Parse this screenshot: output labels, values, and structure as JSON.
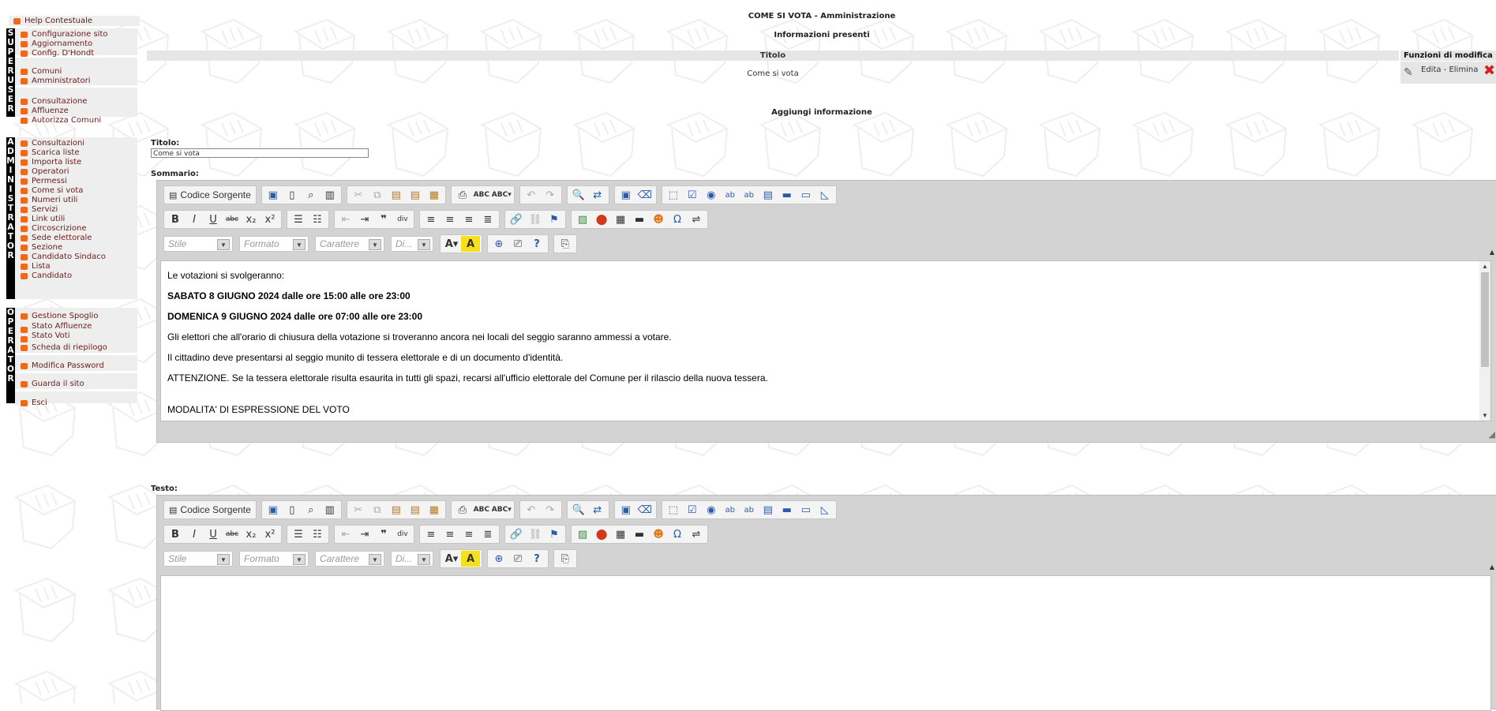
{
  "sidebar": {
    "help": "Help Contestuale",
    "groups": [
      {
        "letters": [
          "S",
          "U",
          "P",
          "E",
          "R",
          "U",
          "S",
          "E",
          "R"
        ],
        "sections": [
          [
            "Configurazione sito",
            "Aggiornamento",
            "Config. D'Hondt"
          ],
          [
            "Comuni",
            "Amministratori"
          ],
          [
            "Consultazione",
            "Affluenze",
            "Autorizza Comuni"
          ]
        ]
      },
      {
        "letters": [
          "A",
          "D",
          "M",
          "I",
          "N",
          "I",
          "S",
          "T",
          "R",
          "A",
          "T",
          "O",
          "R"
        ],
        "items": [
          "Consultazioni",
          "Scarica liste",
          "Importa liste",
          "Operatori",
          "Permessi",
          "Come si vota",
          "Numeri utili",
          "Servizi",
          "Link utili",
          "Circoscrizione",
          "Sede elettorale",
          "Sezione",
          "Candidato Sindaco",
          "Lista",
          "Candidato"
        ]
      },
      {
        "letters": [
          "O",
          "P",
          "E",
          "R",
          "A",
          "T",
          "O",
          "R"
        ],
        "sections": [
          [
            "Gestione Spoglio",
            "Stato Affluenze",
            "Stato Voti",
            "Scheda di riepilogo"
          ],
          [
            "Modifica Password"
          ],
          [
            "Guarda il sito"
          ],
          [
            "Esci"
          ]
        ]
      }
    ]
  },
  "header": {
    "title": "COME SI VOTA - Amministrazione",
    "subtitle": "Informazioni presenti"
  },
  "table": {
    "col_title": "Titolo",
    "col_functions": "Funzioni di modifica",
    "rows": [
      {
        "title": "Come si vota",
        "actions": "Edita - Elimina"
      }
    ]
  },
  "add": {
    "heading": "Aggiungi informazione",
    "title_label": "Titolo:",
    "title_value": "Come si vota",
    "summary_label": "Sommario:",
    "text_label": "Testo:"
  },
  "editor": {
    "source_label": "Codice Sorgente",
    "toolbar1": [
      "save-icon",
      "new-page-icon",
      "preview-icon",
      "templates-icon",
      "|",
      "cut-icon",
      "copy-icon",
      "paste-icon",
      "paste-text-icon",
      "paste-word-icon",
      "|",
      "print-icon",
      "spellcheck-icon",
      "scayt-icon",
      "|",
      "undo-icon",
      "redo-icon",
      "|",
      "find-icon",
      "replace-icon",
      "|",
      "select-all-icon",
      "remove-format-icon",
      "|",
      "form-icon",
      "checkbox-icon",
      "radio-icon",
      "textfield-icon",
      "textarea-icon",
      "select-field-icon",
      "button-icon",
      "image-button-icon",
      "hidden-field-icon"
    ],
    "toolbar2": [
      "B",
      "I",
      "U",
      "abc",
      "x₂",
      "x²",
      "|",
      "ol",
      "ul",
      "|",
      "outdent",
      "indent",
      "quote",
      "div",
      "|",
      "left",
      "center",
      "right",
      "justify",
      "|",
      "link",
      "unlink",
      "anchor",
      "|",
      "image",
      "flash",
      "table",
      "hr",
      "smiley",
      "omega",
      "pagebreak"
    ],
    "combos": [
      "Stile",
      "Formato",
      "Carattere",
      "Di..."
    ],
    "summary_content": [
      "Le votazioni si svolgeranno:",
      "SABATO 8 GIUGNO 2024 dalle ore 15:00 alle ore 23:00",
      "DOMENICA 9 GIUGNO 2024 dalle ore 07:00 alle ore 23:00",
      "Gli elettori che all'orario di chiusura della votazione si troveranno ancora nei locali del seggio saranno ammessi a votare.",
      "Il cittadino deve presentarsi al seggio munito di tessera elettorale e di un documento d'identità.",
      "ATTENZIONE. Se la tessera elettorale risulta esaurita in tutti gli spazi, recarsi all'ufficio elettorale del Comune per il rilascio della nuova tessera.",
      "MODALITA' DI ESPRESSIONE DEL VOTO"
    ]
  }
}
